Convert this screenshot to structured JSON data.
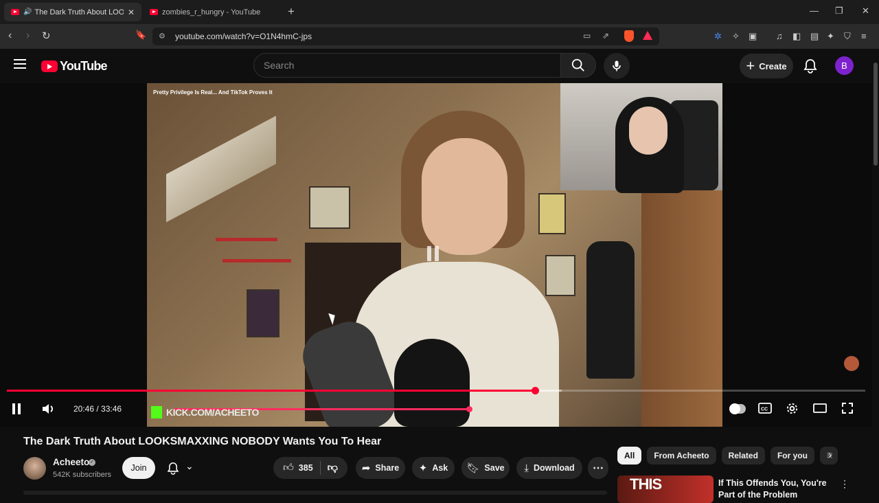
{
  "browser": {
    "tabs": [
      {
        "title": "The Dark Truth About LOOKSMAXXING",
        "active": true,
        "audio": true
      },
      {
        "title": "zombies_r_hungry - YouTube",
        "active": false,
        "audio": false
      }
    ],
    "url": "youtube.com/watch?v=O1N4hmC-jps"
  },
  "header": {
    "logo_text": "YouTube",
    "search_placeholder": "Search",
    "create_label": "Create",
    "avatar_letter": "B"
  },
  "player": {
    "overlay_title": "Pretty Privilege Is Real... And TikTok Proves It",
    "stream_tag": "KICK.COM/ACHEETO",
    "current_time": "20:46",
    "duration": "33:46",
    "time_display": "20:46 / 33:46",
    "progress_fraction": 0.615,
    "state": "playing"
  },
  "video": {
    "title": "The Dark Truth About LOOKSMAXXING NOBODY Wants You To Hear",
    "channel": "Acheeto",
    "subscribers": "542K subscribers",
    "join_label": "Join",
    "likes": "385",
    "share_label": "Share",
    "ask_label": "Ask",
    "save_label": "Save",
    "download_label": "Download"
  },
  "sidebar": {
    "chips": [
      "All",
      "From Acheeto",
      "Related",
      "For you",
      "R"
    ],
    "active_chip": "All",
    "recommendation": {
      "title": "If This Offends You, You're Part of the Problem",
      "thumb_text": "THIS"
    }
  },
  "colors": {
    "accent": "#ff0033",
    "background": "#0f0f0f",
    "pill": "#272727",
    "avatar": "#7e22ce"
  }
}
